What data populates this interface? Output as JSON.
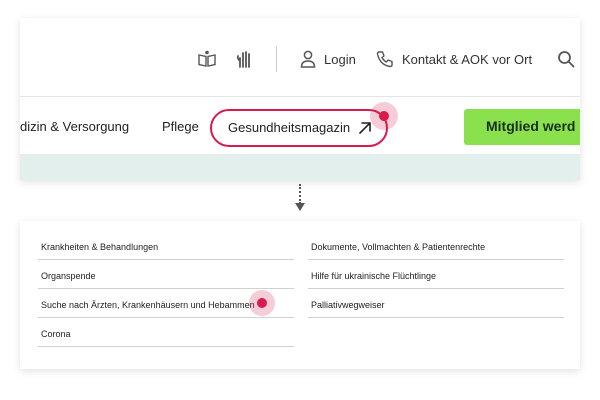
{
  "header": {
    "utility": {
      "login_label": "Login",
      "contact_label": "Kontakt & AOK vor Ort",
      "icons": [
        "easy-language-book-icon",
        "sign-language-icon",
        "user-icon",
        "phone-icon",
        "search-icon"
      ]
    },
    "nav": {
      "items": [
        "dizin & Versorgung",
        "Pflege"
      ],
      "highlighted_item": "Gesundheitsmagazin",
      "member_button": "Mitglied werd"
    }
  },
  "menu": {
    "left": [
      "Krankheiten & Behandlungen",
      "Organspende",
      "Suche nach Ärzten, Krankenhäusern und Hebammen",
      "Corona"
    ],
    "right": [
      "Dokumente, Vollmachten & Patientenrechte",
      "Hilfe für ukrainische Flüchtlinge",
      "Palliativwegweiser"
    ]
  },
  "colors": {
    "accent_red": "#d81b4a",
    "member_green": "#8be04e",
    "hint_band": "#e3efec"
  }
}
